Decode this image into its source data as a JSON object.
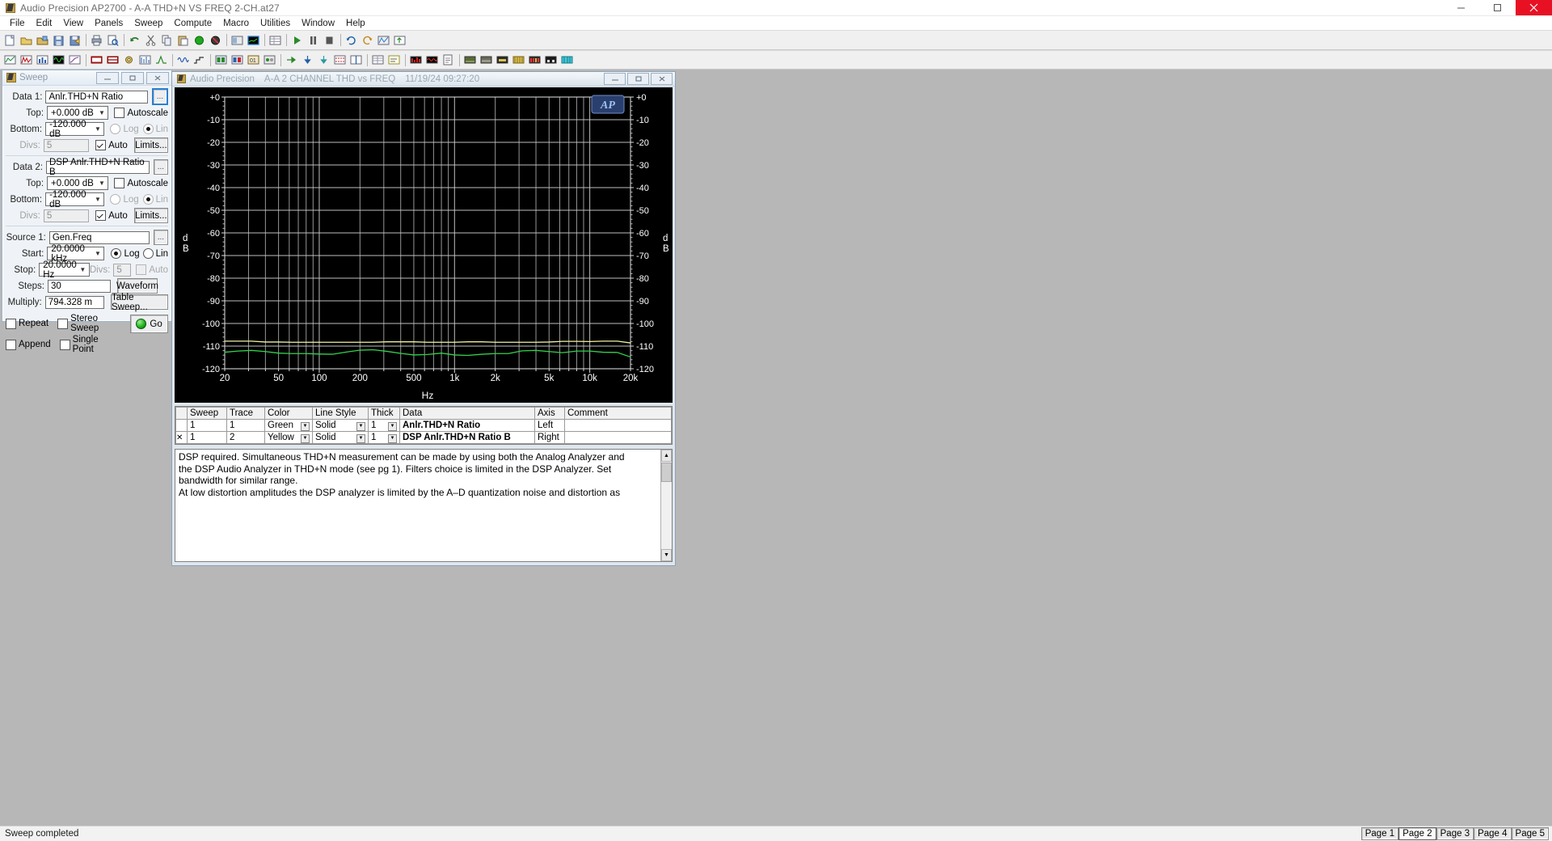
{
  "window": {
    "title": "Audio Precision AP2700 - A-A THD+N VS FREQ 2-CH.at27",
    "minimize": "─",
    "maximize": "❐",
    "close": "✕"
  },
  "menu": [
    "File",
    "Edit",
    "View",
    "Panels",
    "Sweep",
    "Compute",
    "Macro",
    "Utilities",
    "Window",
    "Help"
  ],
  "sweep_panel": {
    "title": "Sweep",
    "min_label": "─",
    "max_label": "□",
    "close_label": "✕",
    "data1": {
      "label": "Data 1:",
      "value": "Anlr.THD+N Ratio",
      "browse": "..."
    },
    "data1_top": {
      "label": "Top:",
      "value": "+0.000   dB",
      "autoscale": "Autoscale"
    },
    "data1_bottom": {
      "label": "Bottom:",
      "value": "-120.000 dB",
      "log": "Log",
      "lin": "Lin"
    },
    "data1_divs": {
      "label": "Divs:",
      "value": "5",
      "auto": "Auto",
      "limits": "Limits..."
    },
    "data2": {
      "label": "Data 2:",
      "value": "DSP Anlr.THD+N Ratio B",
      "browse": "..."
    },
    "data2_top": {
      "label": "Top:",
      "value": "+0.000   dB",
      "autoscale": "Autoscale"
    },
    "data2_bottom": {
      "label": "Bottom:",
      "value": "-120.000 dB",
      "log": "Log",
      "lin": "Lin"
    },
    "data2_divs": {
      "label": "Divs:",
      "value": "5",
      "auto": "Auto",
      "limits": "Limits..."
    },
    "source1": {
      "label": "Source 1:",
      "value": "Gen.Freq",
      "browse": "..."
    },
    "start": {
      "label": "Start:",
      "value": "20.0000 kHz",
      "log": "Log",
      "lin": "Lin"
    },
    "stop": {
      "label": "Stop:",
      "value": "20.0000  Hz",
      "divs_label": "Divs:",
      "divs_value": "5",
      "auto": "Auto"
    },
    "steps": {
      "label": "Steps:",
      "value": "30",
      "waveform": "Waveform"
    },
    "multiply": {
      "label": "Multiply:",
      "value": "794.328 m",
      "table_sweep": "Table Sweep..."
    },
    "options": {
      "repeat": "Repeat",
      "stereo_sweep": "Stereo Sweep",
      "append": "Append",
      "single_point": "Single Point",
      "go": "Go"
    }
  },
  "graph_window": {
    "title_app": "Audio Precision",
    "title_test": "A-A 2 CHANNEL  THD vs FREQ",
    "title_time": "11/19/24 09:27:20",
    "min_label": "─",
    "max_label": "□",
    "close_label": "✕",
    "watermark": "AP"
  },
  "chart_data": {
    "type": "line",
    "title": "A-A 2 CHANNEL  THD vs FREQ",
    "xlabel": "Hz",
    "ylabel": "dB",
    "ylabel_right": "dB",
    "xscale": "log",
    "xlim": [
      20,
      20000
    ],
    "ylim": [
      -120,
      0
    ],
    "grid": true,
    "yticks": [
      "+0",
      "-10",
      "-20",
      "-30",
      "-40",
      "-50",
      "-60",
      "-70",
      "-80",
      "-90",
      "-100",
      "-110",
      "-120"
    ],
    "yticks_right": [
      "+0",
      "-10",
      "-20",
      "-30",
      "-40",
      "-50",
      "-60",
      "-70",
      "-80",
      "-90",
      "-100",
      "-110",
      "-120"
    ],
    "xticks": [
      "20",
      "50",
      "100",
      "200",
      "500",
      "1k",
      "2k",
      "5k",
      "10k",
      "20k"
    ],
    "xtick_values": [
      20,
      50,
      100,
      200,
      500,
      1000,
      2000,
      5000,
      10000,
      20000
    ],
    "series": [
      {
        "name": "Anlr.THD+N Ratio",
        "color": "#f2f2a0",
        "axis": "Left",
        "x": [
          20,
          25,
          31.5,
          40,
          50,
          63,
          80,
          100,
          125,
          160,
          200,
          250,
          315,
          400,
          500,
          630,
          800,
          1000,
          1250,
          1600,
          2000,
          2500,
          3150,
          4000,
          5000,
          6300,
          8000,
          10000,
          12500,
          16000,
          20000
        ],
        "y": [
          -107.8,
          -107.8,
          -107.8,
          -108.2,
          -108.2,
          -108.3,
          -108.3,
          -108.3,
          -108.3,
          -108.3,
          -108.3,
          -108.3,
          -108.1,
          -108.1,
          -108.1,
          -108.3,
          -108.3,
          -108.3,
          -108.1,
          -108.1,
          -108.3,
          -108.3,
          -108.3,
          -108.3,
          -108.2,
          -107.9,
          -107.9,
          -108.0,
          -107.8,
          -107.8,
          -108.6
        ]
      },
      {
        "name": "DSP Anlr.THD+N Ratio B",
        "color": "#33d14a",
        "axis": "Right",
        "x": [
          20,
          25,
          31.5,
          40,
          50,
          63,
          80,
          100,
          125,
          160,
          200,
          250,
          315,
          400,
          500,
          630,
          800,
          1000,
          1250,
          1600,
          2000,
          2500,
          3150,
          4000,
          5000,
          6300,
          8000,
          10000,
          12500,
          16000,
          20000
        ],
        "y": [
          -112.7,
          -112.2,
          -111.9,
          -112.4,
          -113.1,
          -113.3,
          -113.3,
          -113.5,
          -113.6,
          -112.6,
          -111.8,
          -111.6,
          -112.3,
          -113.2,
          -113.9,
          -113.7,
          -113.1,
          -113.9,
          -114.1,
          -113.6,
          -113.3,
          -113.3,
          -112.1,
          -111.9,
          -112.4,
          -112.9,
          -112.2,
          -112.2,
          -112.7,
          -112.8,
          -114.8
        ]
      }
    ]
  },
  "legend": {
    "columns": [
      "",
      "Sweep",
      "Trace",
      "Color",
      "Line Style",
      "Thick",
      "Data",
      "Axis",
      "Comment"
    ],
    "rows": [
      {
        "sel": "",
        "sweep": "1",
        "trace": "1",
        "color": "Green",
        "style": "Solid",
        "thick": "1",
        "data": "Anlr.THD+N Ratio",
        "axis": "Left",
        "comment": ""
      },
      {
        "sel": "✕",
        "sweep": "1",
        "trace": "2",
        "color": "Yellow",
        "style": "Solid",
        "thick": "1",
        "data": "DSP Anlr.THD+N Ratio B",
        "axis": "Right",
        "comment": ""
      }
    ]
  },
  "comment": {
    "lines": [
      "DSP required.   Simultaneous THD+N measurement can be made by using both the Analog Analyzer and",
      "the DSP Audio Analyzer in THD+N mode (see pg 1).   Filters choice is limited in the DSP Analyzer.   Set",
      "bandwidth for similar range.",
      "At low distortion amplitudes the DSP analyzer is limited by the A–D quantization noise and distortion as"
    ],
    "scroll_up": "▲",
    "scroll_down": "▼"
  },
  "statusbar": {
    "message": "Sweep completed",
    "pages": [
      {
        "label": "Page 1",
        "active": false
      },
      {
        "label": "Page 2",
        "active": true
      },
      {
        "label": "Page 3",
        "active": false
      },
      {
        "label": "Page 4",
        "active": false
      },
      {
        "label": "Page 5",
        "active": false
      }
    ]
  }
}
